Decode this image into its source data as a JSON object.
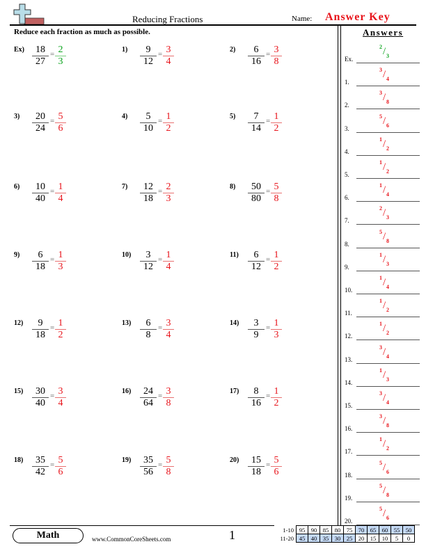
{
  "header": {
    "title": "Reducing Fractions",
    "name_label": "Name:",
    "name_value": "Answer Key",
    "instructions": "Reduce each fraction as much as possible.",
    "answers_title": "Answers"
  },
  "colors": {
    "answer": "#e8141b",
    "example": "#0aa31c",
    "score_highlight": "#c4d9f5"
  },
  "problems": [
    {
      "label": "Ex)",
      "num": "18",
      "den": "27",
      "ans_num": "2",
      "ans_den": "3",
      "example": true
    },
    {
      "label": "1)",
      "num": "9",
      "den": "12",
      "ans_num": "3",
      "ans_den": "4"
    },
    {
      "label": "2)",
      "num": "6",
      "den": "16",
      "ans_num": "3",
      "ans_den": "8"
    },
    {
      "label": "3)",
      "num": "20",
      "den": "24",
      "ans_num": "5",
      "ans_den": "6"
    },
    {
      "label": "4)",
      "num": "5",
      "den": "10",
      "ans_num": "1",
      "ans_den": "2"
    },
    {
      "label": "5)",
      "num": "7",
      "den": "14",
      "ans_num": "1",
      "ans_den": "2"
    },
    {
      "label": "6)",
      "num": "10",
      "den": "40",
      "ans_num": "1",
      "ans_den": "4"
    },
    {
      "label": "7)",
      "num": "12",
      "den": "18",
      "ans_num": "2",
      "ans_den": "3"
    },
    {
      "label": "8)",
      "num": "50",
      "den": "80",
      "ans_num": "5",
      "ans_den": "8"
    },
    {
      "label": "9)",
      "num": "6",
      "den": "18",
      "ans_num": "1",
      "ans_den": "3"
    },
    {
      "label": "10)",
      "num": "3",
      "den": "12",
      "ans_num": "1",
      "ans_den": "4"
    },
    {
      "label": "11)",
      "num": "6",
      "den": "12",
      "ans_num": "1",
      "ans_den": "2"
    },
    {
      "label": "12)",
      "num": "9",
      "den": "18",
      "ans_num": "1",
      "ans_den": "2"
    },
    {
      "label": "13)",
      "num": "6",
      "den": "8",
      "ans_num": "3",
      "ans_den": "4"
    },
    {
      "label": "14)",
      "num": "3",
      "den": "9",
      "ans_num": "1",
      "ans_den": "3"
    },
    {
      "label": "15)",
      "num": "30",
      "den": "40",
      "ans_num": "3",
      "ans_den": "4"
    },
    {
      "label": "16)",
      "num": "24",
      "den": "64",
      "ans_num": "3",
      "ans_den": "8"
    },
    {
      "label": "17)",
      "num": "8",
      "den": "16",
      "ans_num": "1",
      "ans_den": "2"
    },
    {
      "label": "18)",
      "num": "35",
      "den": "42",
      "ans_num": "5",
      "ans_den": "6"
    },
    {
      "label": "19)",
      "num": "35",
      "den": "56",
      "ans_num": "5",
      "ans_den": "8"
    },
    {
      "label": "20)",
      "num": "15",
      "den": "18",
      "ans_num": "5",
      "ans_den": "6"
    }
  ],
  "answer_key": [
    {
      "label": "Ex.",
      "n": "2",
      "d": "3",
      "example": true
    },
    {
      "label": "1.",
      "n": "3",
      "d": "4"
    },
    {
      "label": "2.",
      "n": "3",
      "d": "8"
    },
    {
      "label": "3.",
      "n": "5",
      "d": "6"
    },
    {
      "label": "4.",
      "n": "1",
      "d": "2"
    },
    {
      "label": "5.",
      "n": "1",
      "d": "2"
    },
    {
      "label": "6.",
      "n": "1",
      "d": "4"
    },
    {
      "label": "7.",
      "n": "2",
      "d": "3"
    },
    {
      "label": "8.",
      "n": "5",
      "d": "8"
    },
    {
      "label": "9.",
      "n": "1",
      "d": "3"
    },
    {
      "label": "10.",
      "n": "1",
      "d": "4"
    },
    {
      "label": "11.",
      "n": "1",
      "d": "2"
    },
    {
      "label": "12.",
      "n": "1",
      "d": "2"
    },
    {
      "label": "13.",
      "n": "3",
      "d": "4"
    },
    {
      "label": "14.",
      "n": "1",
      "d": "3"
    },
    {
      "label": "15.",
      "n": "3",
      "d": "4"
    },
    {
      "label": "16.",
      "n": "3",
      "d": "8"
    },
    {
      "label": "17.",
      "n": "1",
      "d": "2"
    },
    {
      "label": "18.",
      "n": "5",
      "d": "6"
    },
    {
      "label": "19.",
      "n": "5",
      "d": "8"
    },
    {
      "label": "20.",
      "n": "5",
      "d": "6"
    }
  ],
  "footer": {
    "subject": "Math",
    "site": "www.CommonCoreSheets.com",
    "page": "1"
  },
  "score_table": {
    "rows": [
      {
        "label": "1-10",
        "values": [
          "95",
          "90",
          "85",
          "80",
          "75",
          "70",
          "65",
          "60",
          "55",
          "50"
        ],
        "highlight": [
          false,
          false,
          false,
          false,
          false,
          true,
          true,
          true,
          true,
          true
        ]
      },
      {
        "label": "11-20",
        "values": [
          "45",
          "40",
          "35",
          "30",
          "25",
          "20",
          "15",
          "10",
          "5",
          "0"
        ],
        "highlight": [
          true,
          true,
          true,
          true,
          true,
          false,
          false,
          false,
          false,
          false
        ]
      }
    ]
  }
}
